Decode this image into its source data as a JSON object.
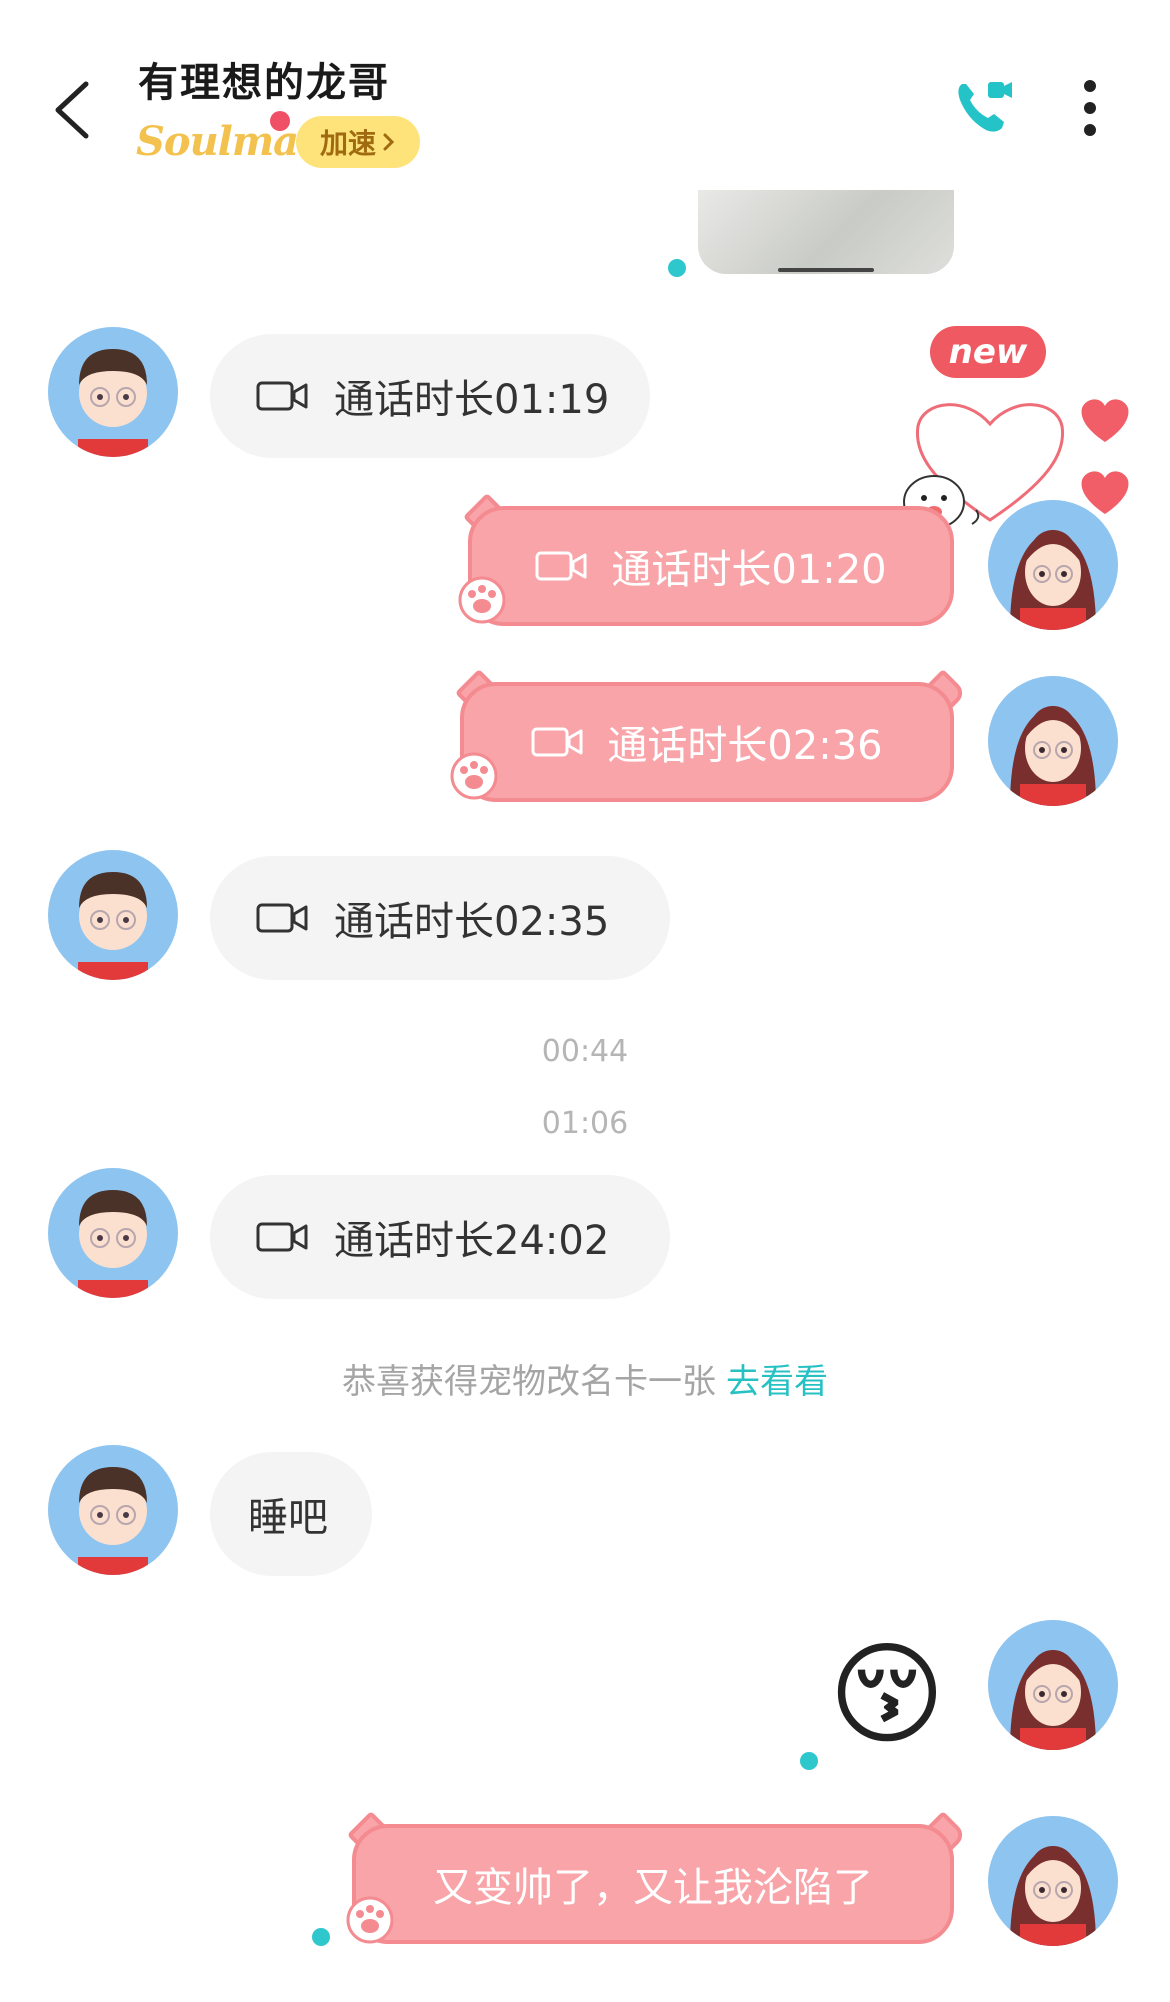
{
  "header": {
    "title": "有理想的龙哥",
    "badge_text": "Soulmate",
    "boost_label": "加速",
    "accent": "#2ec8cc"
  },
  "messages": [
    {
      "side": "in",
      "type": "call",
      "text": "通话时长01:19"
    },
    {
      "side": "out",
      "type": "call",
      "text": "通话时长01:20"
    },
    {
      "side": "out",
      "type": "call",
      "text": "通话时长02:36"
    },
    {
      "side": "in",
      "type": "call",
      "text": "通话时长02:35"
    },
    {
      "side": "in",
      "type": "call",
      "text": "通话时长24:02"
    },
    {
      "side": "in",
      "type": "text",
      "text": "睡吧"
    },
    {
      "side": "out",
      "type": "emoji",
      "text": "😚"
    },
    {
      "side": "out",
      "type": "text",
      "text": "又变帅了，又让我沦陷了"
    }
  ],
  "timestamps": [
    "00:44",
    "01:06"
  ],
  "notice": {
    "text": "恭喜获得宠物改名卡一张",
    "link": "去看看"
  },
  "sticker": {
    "label": "new"
  },
  "colors": {
    "out_bubble": "#f8a4a8",
    "out_border": "#f48b91",
    "in_bubble": "#f4f4f4",
    "link": "#27c1c4",
    "boost_bg": "#fde37a"
  },
  "icons": [
    "back-arrow-icon",
    "video-call-icon",
    "more-vertical-icon",
    "camera-icon",
    "paw-icon",
    "heart-icon"
  ]
}
